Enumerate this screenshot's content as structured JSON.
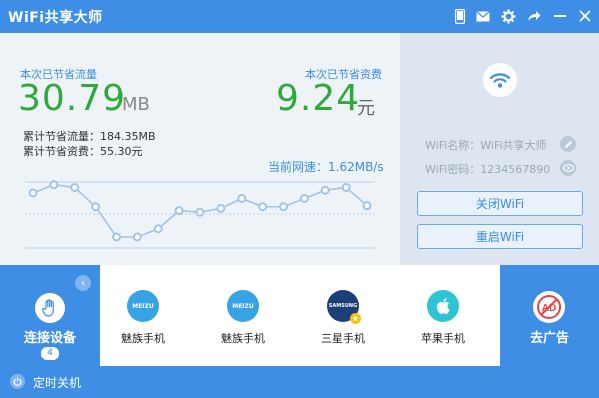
{
  "window": {
    "title": "WiFi共享大师"
  },
  "titlebar": {
    "icons": [
      "phone-icon",
      "mail-icon",
      "gear-icon",
      "share-arrow-icon",
      "minimize-icon",
      "close-icon"
    ]
  },
  "stats": {
    "flow_label": "本次已节省流量",
    "flow_value": "30.79",
    "flow_unit": "MB",
    "fee_label": "本次已节省资费",
    "fee_value": "9.24",
    "fee_unit": "元",
    "total_flow": "累计节省流量：184.35MB",
    "total_fee": "累计节省资费：55.30元",
    "speed": "当前网速：1.62MB/s"
  },
  "chart_data": {
    "type": "line",
    "points": [
      0.2,
      0.05,
      0.1,
      0.45,
      1.0,
      1.0,
      0.85,
      0.52,
      0.55,
      0.48,
      0.3,
      0.45,
      0.45,
      0.3,
      0.15,
      0.1,
      0.43
    ],
    "point_color": "#9fc4ea",
    "line_color": "#9fc4ea"
  },
  "wifi": {
    "name": "WiFi名称：WiFi共享大师",
    "password": "WiFi密码：1234567890",
    "close_button": "关闭WiFi",
    "restart_button": "重启WiFi"
  },
  "devices": {
    "connect_label": "连接设备",
    "count": "4",
    "items": [
      {
        "name": "魅族手机",
        "brand": "MEIZU",
        "color": "#36a3e6",
        "badge": false
      },
      {
        "name": "魅族手机",
        "brand": "MEIZU",
        "color": "#36a3e6",
        "badge": false
      },
      {
        "name": "三星手机",
        "brand": "SAMSUNG",
        "color": "#1c3f7a",
        "badge": true
      },
      {
        "name": "苹果手机",
        "brand": "",
        "color": "#2ec4d6",
        "badge": false
      }
    ],
    "ad_label": "去广告",
    "ad_text": "AD"
  },
  "footer": {
    "timer_label": "定时关机"
  },
  "colors": {
    "accent": "#3f8ee6",
    "value_green": "#2daa3b",
    "label_blue": "#3a8fe0"
  }
}
